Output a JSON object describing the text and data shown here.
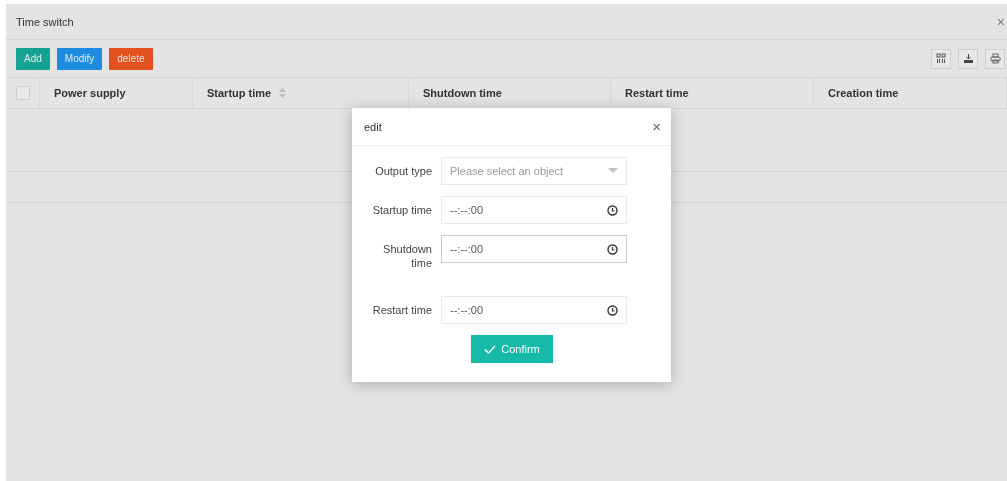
{
  "window": {
    "title": "Time switch",
    "close": "×"
  },
  "toolbar": {
    "buttons": [
      {
        "label": "Add",
        "kind": "add"
      },
      {
        "label": "Modify",
        "kind": "modify"
      },
      {
        "label": "delete",
        "kind": "delete"
      }
    ]
  },
  "table": {
    "select_all": {
      "checked": false
    },
    "columns": [
      {
        "label": "Power supply",
        "sortable": false
      },
      {
        "label": "Startup time",
        "sortable": true
      },
      {
        "label": "Shutdown time",
        "sortable": false
      },
      {
        "label": "Restart time",
        "sortable": false
      },
      {
        "label": "Creation time",
        "sortable": false
      }
    ]
  },
  "dialog": {
    "title": "edit",
    "close": "×",
    "fields": [
      {
        "label": "Output type",
        "kind": "select",
        "placeholder": "Please select an object",
        "focused": false
      },
      {
        "label": "Startup time",
        "kind": "time",
        "value": "--:--:00",
        "focused": false
      },
      {
        "label": "Shutdown time",
        "kind": "time",
        "value": "--:--:00",
        "focused": true
      },
      {
        "label": "Restart time",
        "kind": "time",
        "value": "--:--:00",
        "focused": false
      }
    ],
    "confirm": "Confirm"
  }
}
